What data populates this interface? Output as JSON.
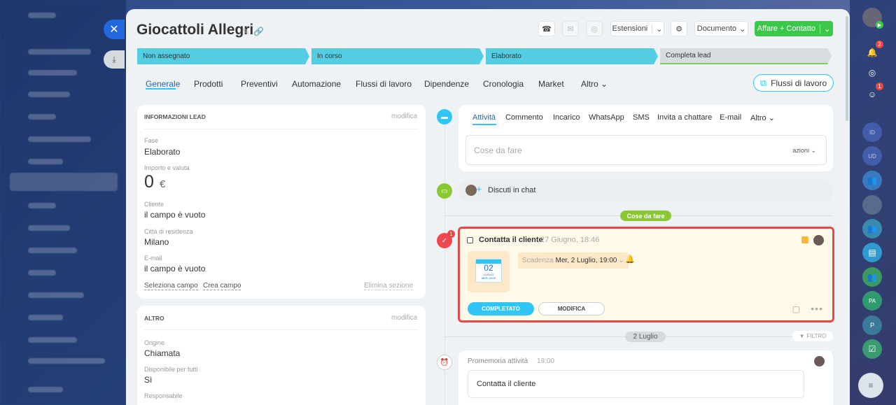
{
  "entity": {
    "title": "Giocattoli Allegri"
  },
  "header": {
    "extensions_label": "Estensioni",
    "document_label": "Documento",
    "add_label": "Affare + Contatto"
  },
  "stages": [
    {
      "label": "Non assegnato"
    },
    {
      "label": "In corso"
    },
    {
      "label": "Elaborato"
    },
    {
      "label": "Completa lead"
    }
  ],
  "tabs": [
    "Generale",
    "Prodotti",
    "Preventivi",
    "Automazione",
    "Flussi di lavoro",
    "Dipendenze",
    "Cronologia",
    "Market",
    "Altro"
  ],
  "workflows_button": "Flussi di lavoro",
  "lead_info": {
    "heading": "INFORMAZIONI LEAD",
    "edit": "modifica",
    "fields": [
      {
        "label": "Fase",
        "value": "Elaborato"
      },
      {
        "label": "Importo e valuta",
        "value": "0",
        "currency": "€"
      },
      {
        "label": "Cliente",
        "value": "il campo è vuoto"
      },
      {
        "label": "Città di residenza",
        "value": "Milano"
      },
      {
        "label": "E-mail",
        "value": "il campo è vuoto"
      }
    ],
    "select_field": "Seleziona campo",
    "create_field": "Crea campo",
    "delete_section": "Elimina sezione"
  },
  "other": {
    "heading": "ALTRO",
    "edit": "modifica",
    "fields": [
      {
        "label": "Origine",
        "value": "Chiamata"
      },
      {
        "label": "Disponibile per tutti",
        "value": "Sì"
      },
      {
        "label": "Responsabile",
        "value": ""
      }
    ]
  },
  "activity_tabs": [
    "Attività",
    "Commento",
    "Incarico",
    "WhatsApp",
    "SMS",
    "Invita a chattare",
    "E-mail",
    "Altro"
  ],
  "todo_input": {
    "placeholder": "Cose da fare",
    "actions": "azioni"
  },
  "chat": {
    "label": "Discuti in chat"
  },
  "todo_section_label": "Cose da fare",
  "todo_item": {
    "title": "Contatta il cliente",
    "created": "27 Giugno, 18:46",
    "badge": "1",
    "cal_day": "02",
    "cal_month": "LUGLIO",
    "cal_weekday": "MER 19:00",
    "deadline_label": "Scadenza",
    "deadline_value": "Mer, 2 Luglio, 19:00",
    "complete_button": "COMPLETATO",
    "edit_button": "MODIFICA"
  },
  "date_separator": "2 Luglio",
  "filter_label": "FILTRO",
  "reminder": {
    "title": "Promemoria attività",
    "time": "19:00",
    "text": "Contatta il cliente"
  },
  "right_rail": {
    "badges": [
      "2",
      "1"
    ],
    "initials": [
      "ID",
      "UD",
      "PA",
      "P"
    ]
  },
  "colors": {
    "accent": "#2fc6f6",
    "stage": "#54cde2",
    "green": "#3bc84a",
    "alert": "#e24a4a"
  }
}
